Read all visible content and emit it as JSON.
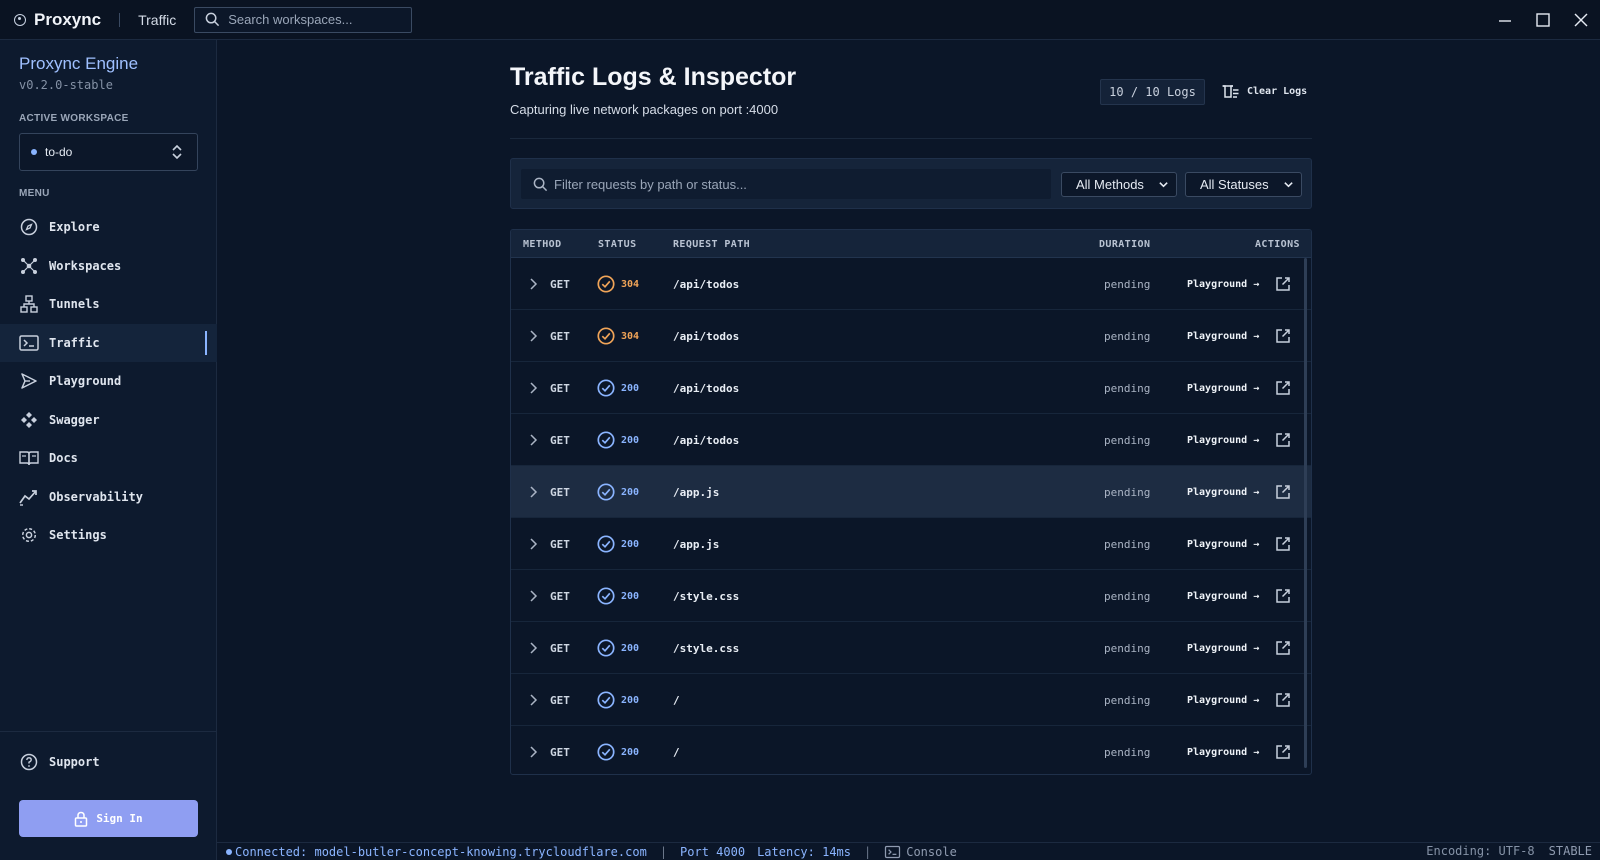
{
  "titlebar": {
    "app_name": "Proxync",
    "crumb": "Traffic",
    "search_placeholder": "Search workspaces..."
  },
  "sidebar": {
    "title": "Proxync Engine",
    "version": "v0.2.0-stable",
    "active_workspace_label": "ACTIVE WORKSPACE",
    "workspace": "to-do",
    "menu_label": "MENU",
    "items": [
      {
        "label": "Explore",
        "icon": "compass-icon"
      },
      {
        "label": "Workspaces",
        "icon": "workspaces-icon"
      },
      {
        "label": "Tunnels",
        "icon": "tunnels-icon"
      },
      {
        "label": "Traffic",
        "icon": "terminal-icon",
        "active": true
      },
      {
        "label": "Playground",
        "icon": "send-icon"
      },
      {
        "label": "Swagger",
        "icon": "swagger-icon"
      },
      {
        "label": "Docs",
        "icon": "book-icon"
      },
      {
        "label": "Observability",
        "icon": "chart-line-icon"
      },
      {
        "label": "Settings",
        "icon": "gear-icon"
      }
    ],
    "support": "Support",
    "sign_in": "Sign In"
  },
  "main": {
    "title": "Traffic Logs & Inspector",
    "subtitle": "Capturing live network packages on port :4000",
    "log_count": "10 / 10 Logs",
    "clear_label": "Clear Logs",
    "filter_placeholder": "Filter requests by path or status...",
    "method_filter": "All Methods",
    "status_filter": "All Statuses"
  },
  "table": {
    "headers": {
      "method": "METHOD",
      "status": "STATUS",
      "path": "REQUEST PATH",
      "duration": "DURATION",
      "actions": "ACTIONS"
    },
    "rows": [
      {
        "method": "GET",
        "status": "304",
        "path": "/api/todos",
        "duration": "pending",
        "action": "Playground →"
      },
      {
        "method": "GET",
        "status": "304",
        "path": "/api/todos",
        "duration": "pending",
        "action": "Playground →"
      },
      {
        "method": "GET",
        "status": "200",
        "path": "/api/todos",
        "duration": "pending",
        "action": "Playground →"
      },
      {
        "method": "GET",
        "status": "200",
        "path": "/api/todos",
        "duration": "pending",
        "action": "Playground →"
      },
      {
        "method": "GET",
        "status": "200",
        "path": "/app.js",
        "duration": "pending",
        "action": "Playground →"
      },
      {
        "method": "GET",
        "status": "200",
        "path": "/app.js",
        "duration": "pending",
        "action": "Playground →"
      },
      {
        "method": "GET",
        "status": "200",
        "path": "/style.css",
        "duration": "pending",
        "action": "Playground →"
      },
      {
        "method": "GET",
        "status": "200",
        "path": "/style.css",
        "duration": "pending",
        "action": "Playground →"
      },
      {
        "method": "GET",
        "status": "200",
        "path": "/",
        "duration": "pending",
        "action": "Playground →"
      },
      {
        "method": "GET",
        "status": "200",
        "path": "/",
        "duration": "pending",
        "action": "Playground →"
      }
    ]
  },
  "statusbar": {
    "connection": "Connected: model-butler-concept-knowing.trycloudflare.com",
    "port": "Port 4000",
    "latency": "Latency: 14ms",
    "console": "Console",
    "encoding": "Encoding: UTF-8",
    "stable": "STABLE"
  },
  "colors": {
    "accent": "#8ab4ff",
    "status_304": "#f0a458",
    "status_200": "#8ab4ff",
    "sign_in_bg": "#8f9ef2"
  }
}
